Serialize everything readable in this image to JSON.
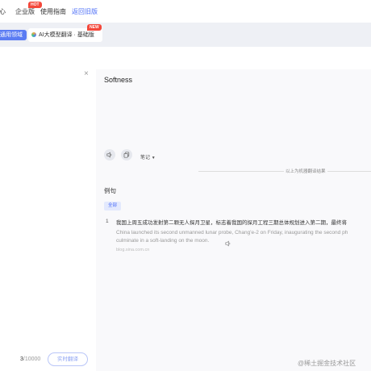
{
  "nav": {
    "items": [
      {
        "label": "心",
        "active": false
      },
      {
        "label": "企业版",
        "active": false
      },
      {
        "label": "使用指南",
        "active": false
      },
      {
        "label": "返回旧版",
        "active": true
      }
    ],
    "hot_badge": "HOT"
  },
  "modes": {
    "general": "通用领域",
    "ai": "AI大模型翻译 · 基础版",
    "new_badge": "NEW"
  },
  "source": {
    "clear": "×",
    "count_current": "3",
    "count_max": "/10000",
    "live_translate": "实时翻译"
  },
  "result": {
    "text": "Softness",
    "note_label": "笔记",
    "machine_label": "以上为机器翻译结果"
  },
  "examples": {
    "title": "例句",
    "filter_all": "全部",
    "items": [
      {
        "index": "1",
        "zh": "我国上周五成功发射第二颗无人探月卫星，标志着我国的探月工程三期总体规划进入第二期，最终将",
        "en_line1": "China launched its second unmanned lunar probe, Chang'e-2 on Friday, inaugurating the second ph",
        "en_line2": "culminate in a soft-landing on the moon.",
        "source": "blog.sina.com.cn"
      }
    ]
  },
  "watermark": "@稀土掘金技术社区",
  "colors": {
    "accent": "#4a6cf7",
    "hot": "#f4483b"
  }
}
